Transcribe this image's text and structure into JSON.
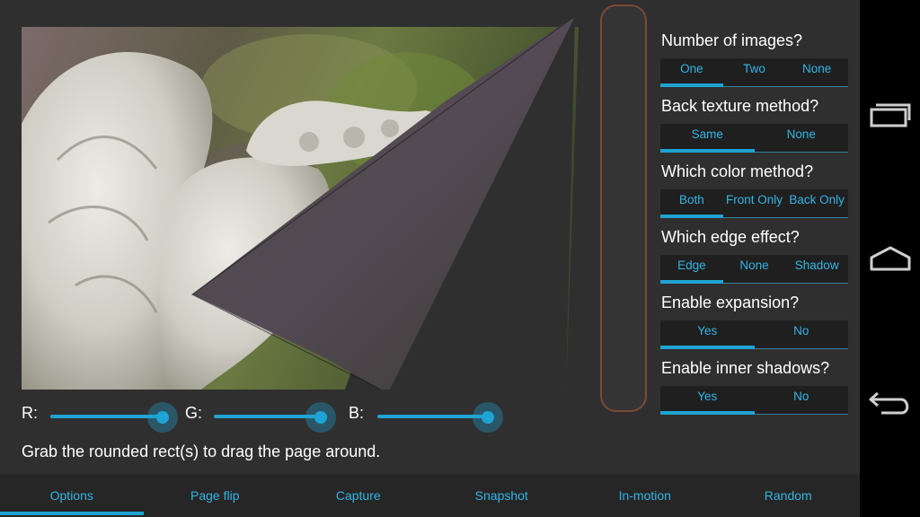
{
  "preview": {
    "image_description_icon": "angel-statue-photo"
  },
  "sliders": [
    {
      "label": "R:",
      "value": 1.0
    },
    {
      "label": "G:",
      "value": 1.0
    },
    {
      "label": "B:",
      "value": 1.0
    }
  ],
  "hint": "Grab the rounded rect(s) to drag the page around.",
  "options": [
    {
      "title": "Number of images?",
      "choices": [
        "One",
        "Two",
        "None"
      ],
      "selected": 0
    },
    {
      "title": "Back texture method?",
      "choices": [
        "Same",
        "None"
      ],
      "selected": 0
    },
    {
      "title": "Which color method?",
      "choices": [
        "Both",
        "Front Only",
        "Back Only"
      ],
      "selected": 0
    },
    {
      "title": "Which edge effect?",
      "choices": [
        "Edge",
        "None",
        "Shadow"
      ],
      "selected": 0
    },
    {
      "title": "Enable expansion?",
      "choices": [
        "Yes",
        "No"
      ],
      "selected": 0
    },
    {
      "title": "Enable inner shadows?",
      "choices": [
        "Yes",
        "No"
      ],
      "selected": 0
    }
  ],
  "tabs": [
    {
      "label": "Options",
      "selected": true
    },
    {
      "label": "Page flip",
      "selected": false
    },
    {
      "label": "Capture",
      "selected": false
    },
    {
      "label": "Snapshot",
      "selected": false
    },
    {
      "label": "In-motion",
      "selected": false
    },
    {
      "label": "Random",
      "selected": false
    }
  ],
  "nav": {
    "icons": [
      "recent-apps-icon",
      "home-icon",
      "back-icon"
    ]
  },
  "colors": {
    "accent": "#1fa3d3",
    "accent_text": "#33b5e5",
    "background": "#2f2f2f",
    "handle_border": "#7a4a33"
  }
}
